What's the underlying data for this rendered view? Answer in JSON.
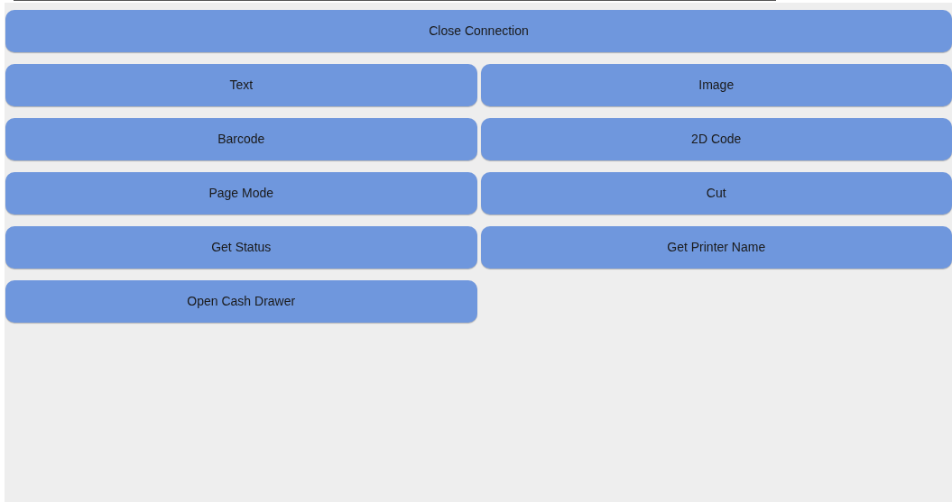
{
  "top_button": {
    "label": "Close Connection"
  },
  "buttons": [
    {
      "label": "Text"
    },
    {
      "label": "Image"
    },
    {
      "label": "Barcode"
    },
    {
      "label": "2D Code"
    },
    {
      "label": "Page Mode"
    },
    {
      "label": "Cut"
    },
    {
      "label": "Get Status"
    },
    {
      "label": "Get Printer Name"
    },
    {
      "label": "Open Cash Drawer"
    }
  ]
}
